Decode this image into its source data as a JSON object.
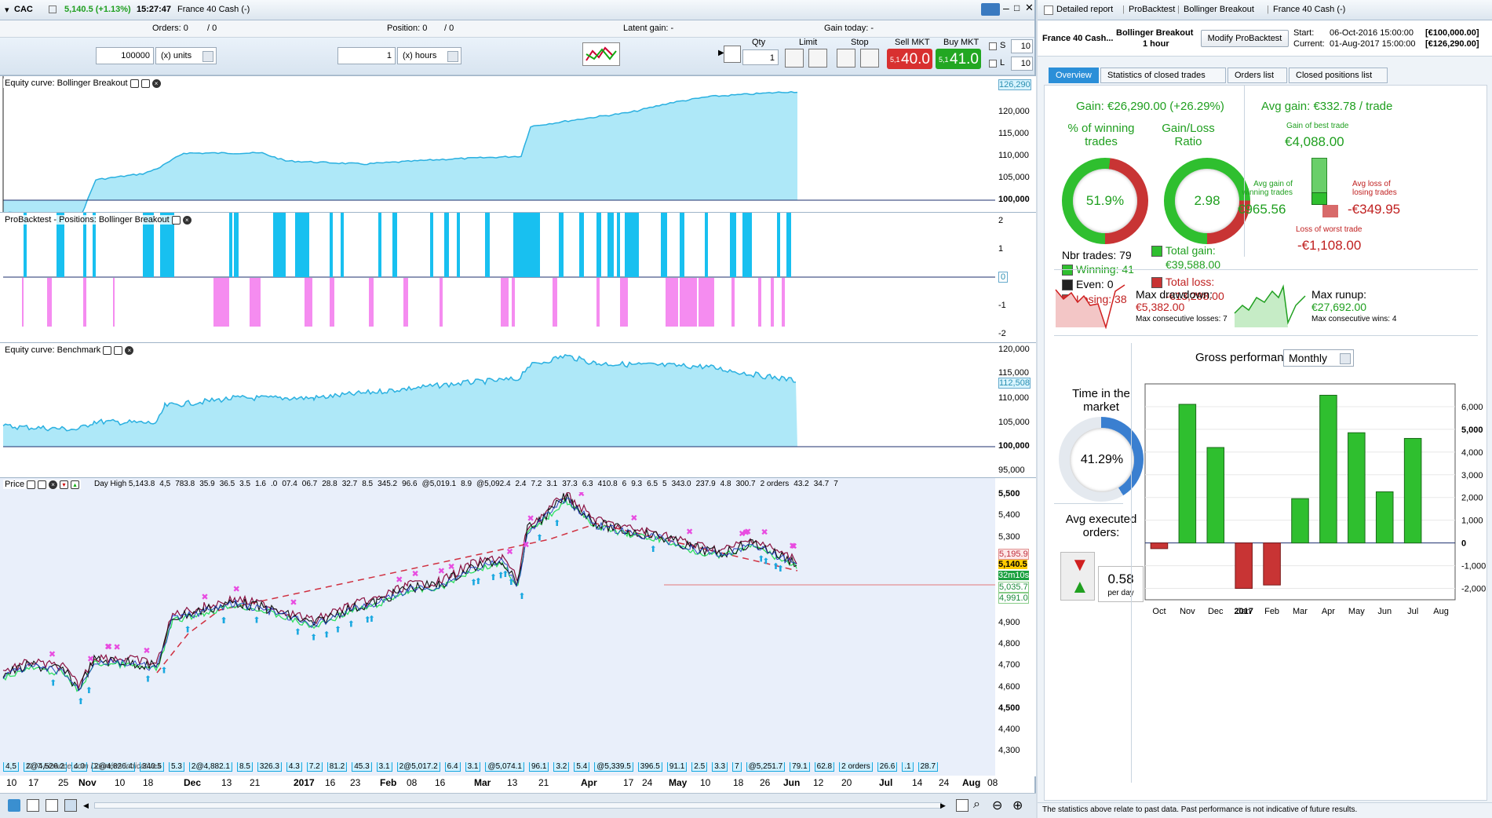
{
  "left_window": {
    "title": {
      "symbol": "CAC",
      "price_change": "5,140.5 (+1.13%)",
      "time": "15:27:47",
      "instrument": "France 40 Cash (-)"
    },
    "header": {
      "orders_label": "Orders: 0",
      "orders_slash": "/ 0",
      "position_label": "Position: 0",
      "position_slash": "/ 0",
      "latent_gain": "Latent gain: -",
      "gain_today": "Gain today: -"
    },
    "controls": {
      "units_value": "100000",
      "units_select": "(x) units",
      "hours_value": "1",
      "hours_select": "(x) hours",
      "qty_label": "Qty",
      "qty_value": "1",
      "limit_label": "Limit",
      "stop_label": "Stop",
      "sell_label": "Sell MKT",
      "sell_price": "40.0",
      "sell_prefix": "5,1",
      "buy_label": "Buy MKT",
      "buy_price": "41.0",
      "buy_prefix": "5,1",
      "s_label": "S",
      "s_value": "10",
      "l_label": "L",
      "l_value": "10"
    },
    "panels": {
      "equity_title": "Equity curve: Bollinger Breakout",
      "equity_current": "126,290",
      "equity_yticks": [
        "125,000",
        "120,000",
        "115,000",
        "110,000",
        "105,000",
        "100,000"
      ],
      "positions_title": "ProBacktest - Positions: Bollinger Breakout",
      "positions_yticks": [
        "2",
        "1",
        "0",
        "-1",
        "-2"
      ],
      "bench_title": "Equity curve: Benchmark",
      "bench_current": "112,508",
      "bench_yticks": [
        "120,000",
        "115,000",
        "110,000",
        "105,000",
        "100,000",
        "95,000"
      ],
      "price_title": "Price",
      "price_yticks": [
        "5,500",
        "5,400",
        "5,300",
        "5,200",
        "5,100",
        "5,000",
        "4,900",
        "4,800",
        "4,700",
        "4,600",
        "4,500",
        "4,400",
        "4,300"
      ],
      "price_tags": {
        "upper": "5,195.9",
        "current": "5,140.5",
        "countdown": "32m10s",
        "lower1": "5,035.7",
        "lower2": "4,991.0"
      },
      "watermark": "© IT-Finance.com  Données indicatives",
      "top_annotations": [
        "Day High 5,143.8",
        "4,5",
        "783.8",
        "35.9",
        "36.5",
        "3.5",
        "1.6",
        ".0",
        "07.4",
        "06.7",
        "28.8",
        "32.7",
        "8.5",
        "345.2",
        "96.6",
        "@5,019.1",
        "8.9",
        "@5,092.4",
        "2.4",
        "7.2",
        "3.1",
        "37.3",
        "6.3",
        "410.8",
        "6",
        "9.3",
        "6.5",
        "5",
        "343.0",
        "237.9",
        "4.8",
        "300.7",
        "2 orders",
        "43.2",
        "34.7",
        "7"
      ],
      "bottom_annotations": [
        "4,5",
        "2@4,526.2",
        "4.0",
        "2@4,826.4",
        "340.5",
        "5.3",
        "2@4,882.1",
        "8.5",
        "326.3",
        "4.3",
        "7.2",
        "81.2",
        "45.3",
        "3.1",
        "2@5,017.2",
        "6.4",
        "3.1",
        "@5,074.1",
        "96.1",
        "3.2",
        "5.4",
        "@5,339.5",
        "396.5",
        "91.1",
        "2.5",
        "3.3",
        "7",
        "@5,251.7",
        "79.1",
        "62.8",
        "2 orders",
        "26.6",
        ".1",
        "28.7"
      ]
    },
    "xaxis": [
      "10",
      "17",
      "25",
      "Nov",
      "10",
      "18",
      "Dec",
      "13",
      "21",
      "2017",
      "16",
      "23",
      "Feb",
      "08",
      "16",
      "Mar",
      "13",
      "21",
      "Apr",
      "17",
      "24",
      "May",
      "10",
      "18",
      "26",
      "Jun",
      "12",
      "20",
      "Jul",
      "14",
      "24",
      "Aug",
      "08"
    ]
  },
  "right_window": {
    "title_items": [
      "Detailed report",
      "ProBacktest",
      "Bollinger Breakout",
      "France 40 Cash (-)"
    ],
    "instrument": "France 40 Cash...",
    "strategy": "Bollinger Breakout",
    "timeframe": "1 hour",
    "modify_button": "Modify ProBacktest",
    "start_label": "Start:",
    "start_value": "06-Oct-2016 15:00:00",
    "start_capital": "[€100,000.00]",
    "current_label": "Current:",
    "current_value": "01-Aug-2017 15:00:00",
    "current_capital": "[€126,290.00]",
    "tabs": [
      "Overview",
      "Statistics of closed trades",
      "Orders list",
      "Closed positions list"
    ],
    "overview": {
      "gain": "Gain: €26,290.00 (+26.29%)",
      "pct_winning_label": "% of winning trades",
      "pct_winning": "51.9%",
      "pct_winning_fraction": 0.519,
      "gl_ratio_label": "Gain/Loss Ratio",
      "gl_ratio": "2.98",
      "gl_ratio_fraction": 0.749,
      "nbr_trades": "Nbr trades: 79",
      "winning": "Winning: 41",
      "even": "Even: 0",
      "losing": "Losing: 38",
      "total_gain_label": "Total gain:",
      "total_gain": "€39,588.00",
      "total_loss_label": "Total loss:",
      "total_loss": "-€13,298.00",
      "avg_gain": "Avg gain: €332.78 / trade",
      "best_trade_label": "Gain of best trade",
      "best_trade": "€4,088.00",
      "avg_win_label": "Avg gain of winning trades",
      "avg_win": "€965.56",
      "avg_loss_label": "Avg loss of losing trades",
      "avg_loss": "-€349.95",
      "worst_trade_label": "Loss of worst trade",
      "worst_trade": "-€1,108.00",
      "max_drawdown_label": "Max drawdown:",
      "max_drawdown": "€5,382.00",
      "max_consec_losses": "Max consecutive losses: 7",
      "max_runup_label": "Max runup:",
      "max_runup": "€27,692.00",
      "max_consec_wins": "Max consecutive wins: 4",
      "time_in_market_label": "Time in the market",
      "time_in_market": "41.29%",
      "time_in_market_fraction": 0.4129,
      "avg_orders_label": "Avg executed orders:",
      "avg_orders": "0.58",
      "avg_orders_unit": "per day",
      "gross_perf_label": "Gross performance",
      "gross_perf_select": "Monthly",
      "footer": "The statistics above relate to past data. Past performance is not indicative of future results."
    }
  },
  "chart_data": {
    "type": "bar",
    "title": "Gross performance",
    "categories": [
      "Oct",
      "Nov",
      "Dec",
      "Jan",
      "Feb",
      "Mar",
      "Apr",
      "May",
      "Jun",
      "Jul",
      "Aug"
    ],
    "year_label": "2017",
    "values": [
      -250,
      6100,
      4200,
      -2000,
      -1850,
      1950,
      6500,
      4850,
      2250,
      4600,
      0
    ],
    "ylim": [
      -2500,
      7000
    ],
    "yticks": [
      6000,
      5000,
      4000,
      3000,
      2000,
      1000,
      0,
      -1000,
      -2000
    ],
    "ytick_labels": [
      "6,000",
      "5,000",
      "4,000",
      "3,000",
      "2,000",
      "1,000",
      "0",
      "-1,000",
      "-2,000"
    ],
    "colors": {
      "positive": "#2fbf2f",
      "negative": "#c83434"
    }
  }
}
